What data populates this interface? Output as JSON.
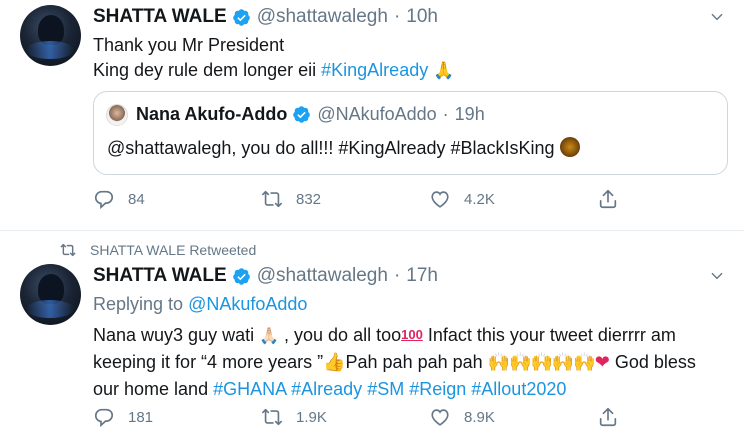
{
  "tweets": [
    {
      "display_name": "SHATTA WALE",
      "handle": "@shattawalegh",
      "time": "10h",
      "text_line1": "Thank you Mr President",
      "text_line2": "King dey rule dem longer eii ",
      "hashtag": "#KingAlready",
      "quote": {
        "display_name": "Nana Akufo-Addo",
        "handle": "@NAkufoAddo",
        "time": "19h",
        "text": "@shattawalegh, you do all!!! ",
        "hashtag1": "#KingAlready",
        "hashtag2": "#BlackIsKing"
      },
      "actions": {
        "replies": "84",
        "retweets": "832",
        "likes": "4.2K"
      }
    },
    {
      "retweet_banner": "SHATTA WALE Retweeted",
      "display_name": "SHATTA WALE",
      "handle": "@shattawalegh",
      "time": "17h",
      "replying_to_label": "Replying to ",
      "replying_to_handle": "@NAkufoAddo",
      "line1_a": "Nana wuy3 guy wati ",
      "line1_b": " , you do all too",
      "line1_c": " Infact this your tweet dierrrr am",
      "line2_a": "keeping it for “4 more years ”",
      "line2_b": "Pah pah pah pah ",
      "line2_c": " God bless",
      "line3_a": "our home land ",
      "hashtags": [
        "#GHANA",
        "#Already",
        "#SM",
        "#Reign",
        "#Allout2020"
      ],
      "actions": {
        "replies": "181",
        "retweets": "1.9K",
        "likes": "8.9K"
      }
    }
  ],
  "colors": {
    "link": "#1b95e0",
    "secondary": "#657786",
    "verified": "#1da1f2",
    "border": "#e6ecf0"
  },
  "icons": [
    "verified-badge-icon",
    "chevron-down-icon",
    "reply-icon",
    "retweet-icon",
    "like-icon",
    "share-icon"
  ]
}
